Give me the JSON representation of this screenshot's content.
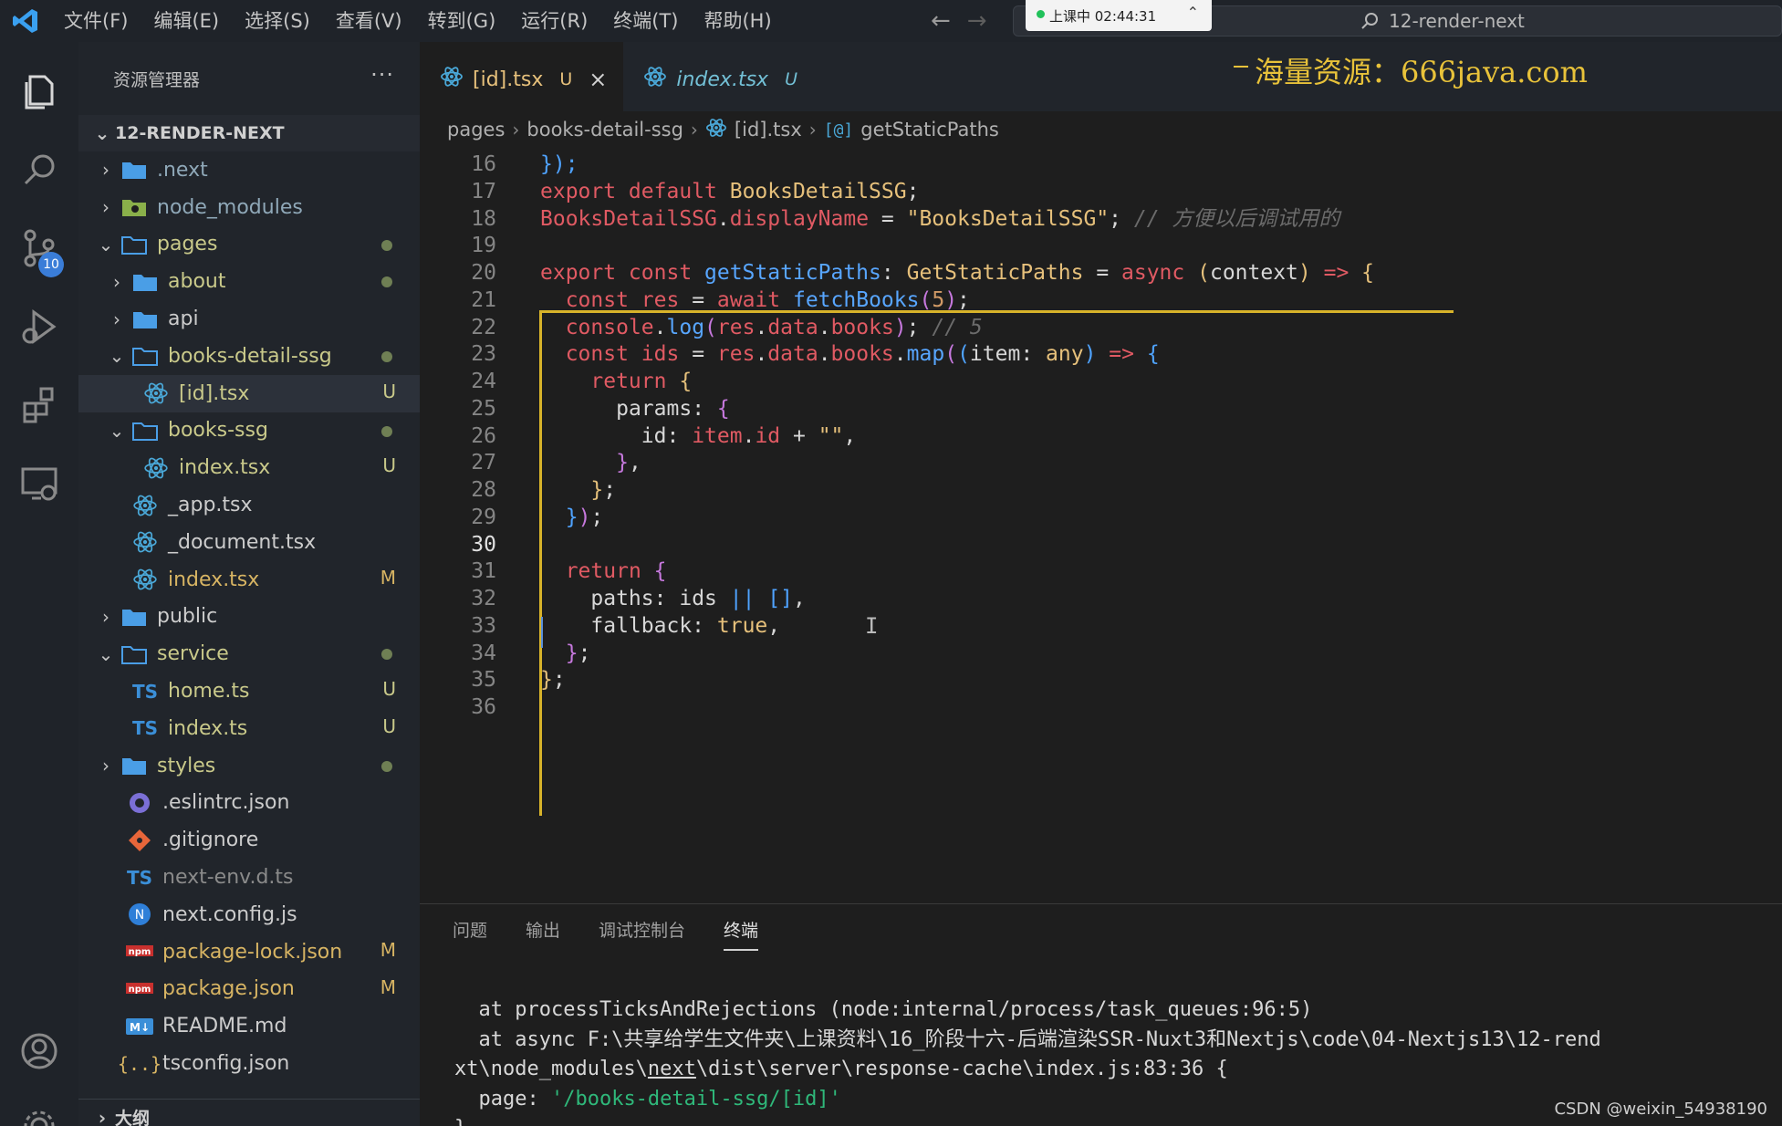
{
  "titlebar": {
    "menu": [
      "文件(F)",
      "编辑(E)",
      "选择(S)",
      "查看(V)",
      "转到(G)",
      "运行(R)",
      "终端(T)",
      "帮助(H)"
    ],
    "nav_back": "←",
    "nav_forward": "→",
    "recording": "上课中 02:44:31",
    "search": "12-render-next"
  },
  "activity_badge": "10",
  "sidebar": {
    "title": "资源管理器",
    "more": "···",
    "root": "12-RENDER-NEXT",
    "outline": "大纲",
    "items": [
      {
        "name": ".next",
        "chev": "›",
        "icon": "folder",
        "color": "#8fa8b8"
      },
      {
        "name": "node_modules",
        "chev": "›",
        "icon": "folder-node",
        "color": "#8fa8b8"
      },
      {
        "name": "pages",
        "chev": "⌄",
        "icon": "folder-open",
        "color": "#c9c98a",
        "status": "dot"
      },
      {
        "name": "about",
        "chev": "›",
        "icon": "folder",
        "color": "#c9c98a",
        "status": "dot"
      },
      {
        "name": "api",
        "chev": "›",
        "icon": "folder",
        "color": "#cccccc"
      },
      {
        "name": "books-detail-ssg",
        "chev": "⌄",
        "icon": "folder-open",
        "color": "#c9c98a",
        "status": "dot"
      },
      {
        "name": "[id].tsx",
        "icon": "react",
        "color": "#c9c98a",
        "status": "U"
      },
      {
        "name": "books-ssg",
        "chev": "⌄",
        "icon": "folder-open",
        "color": "#c9c98a",
        "status": "dot"
      },
      {
        "name": "index.tsx",
        "icon": "react",
        "color": "#c9c98a",
        "status": "U"
      },
      {
        "name": "_app.tsx",
        "icon": "react",
        "color": "#cccccc"
      },
      {
        "name": "_document.tsx",
        "icon": "react",
        "color": "#cccccc"
      },
      {
        "name": "index.tsx",
        "icon": "react",
        "color": "#d7b463",
        "status": "M"
      },
      {
        "name": "public",
        "chev": "›",
        "icon": "folder",
        "color": "#cccccc"
      },
      {
        "name": "service",
        "chev": "⌄",
        "icon": "folder-open",
        "color": "#c9c98a",
        "status": "dot"
      },
      {
        "name": "home.ts",
        "icon": "ts",
        "color": "#c9c98a",
        "status": "U"
      },
      {
        "name": "index.ts",
        "icon": "ts",
        "color": "#c9c98a",
        "status": "U"
      },
      {
        "name": "styles",
        "chev": "›",
        "icon": "folder",
        "color": "#c9c98a",
        "status": "dot"
      },
      {
        "name": ".eslintrc.json",
        "icon": "eslint",
        "color": "#cccccc"
      },
      {
        "name": ".gitignore",
        "icon": "git",
        "color": "#cccccc"
      },
      {
        "name": "next-env.d.ts",
        "icon": "ts",
        "color": "#8a8a8a"
      },
      {
        "name": "next.config.js",
        "icon": "next",
        "color": "#cccccc"
      },
      {
        "name": "package-lock.json",
        "icon": "npm",
        "color": "#d7b463",
        "status": "M"
      },
      {
        "name": "package.json",
        "icon": "npm",
        "color": "#d7b463",
        "status": "M"
      },
      {
        "name": "README.md",
        "icon": "md",
        "color": "#cccccc"
      },
      {
        "name": "tsconfig.json",
        "icon": "json",
        "color": "#cccccc"
      }
    ]
  },
  "tabs": [
    {
      "label": "[id].tsx",
      "status": "U",
      "close": "×"
    },
    {
      "label": "index.tsx",
      "status": "U"
    }
  ],
  "watermark": "海量资源：666java.com",
  "breadcrumb": [
    "pages",
    "books-detail-ssg",
    "[id].tsx",
    "getStaticPaths"
  ],
  "code": [
    {
      "n": "16",
      "t": [
        [
          "br3",
          "});"
        ]
      ]
    },
    {
      "n": "17",
      "t": [
        [
          "kw",
          "export default "
        ],
        [
          "ty",
          "BooksDetailSSG"
        ],
        [
          "pun",
          ";"
        ]
      ]
    },
    {
      "n": "18",
      "t": [
        [
          "red",
          "BooksDetailSSG"
        ],
        [
          "pun",
          "."
        ],
        [
          "red",
          "displayName"
        ],
        [
          "pun",
          " = "
        ],
        [
          "str",
          "\"BooksDetailSSG\""
        ],
        [
          "pun",
          "; "
        ],
        [
          "cmt",
          "// 方便以后调试用的"
        ]
      ]
    },
    {
      "n": "19",
      "t": []
    },
    {
      "n": "20",
      "t": [
        [
          "kw",
          "export const "
        ],
        [
          "fn",
          "getStaticPaths"
        ],
        [
          "pun",
          ": "
        ],
        [
          "ty",
          "GetStaticPaths"
        ],
        [
          "pun",
          " = "
        ],
        [
          "kw",
          "async "
        ],
        [
          "br1",
          "("
        ],
        [
          "plain",
          "context"
        ],
        [
          "br1",
          ")"
        ],
        [
          "kw",
          " => "
        ],
        [
          "br1",
          "{"
        ]
      ]
    },
    {
      "n": "21",
      "t": [
        [
          "plain",
          "  "
        ],
        [
          "kw",
          "const "
        ],
        [
          "red",
          "res"
        ],
        [
          "pun",
          " = "
        ],
        [
          "kw",
          "await "
        ],
        [
          "fn",
          "fetchBooks"
        ],
        [
          "br2",
          "("
        ],
        [
          "num",
          "5"
        ],
        [
          "br2",
          ")"
        ],
        [
          "pun",
          ";"
        ]
      ]
    },
    {
      "n": "22",
      "t": [
        [
          "plain",
          "  "
        ],
        [
          "red",
          "console"
        ],
        [
          "pun",
          "."
        ],
        [
          "fn",
          "log"
        ],
        [
          "br2",
          "("
        ],
        [
          "red",
          "res"
        ],
        [
          "pun",
          "."
        ],
        [
          "red",
          "data"
        ],
        [
          "pun",
          "."
        ],
        [
          "red",
          "books"
        ],
        [
          "br2",
          ")"
        ],
        [
          "pun",
          "; "
        ],
        [
          "cmt",
          "// 5"
        ]
      ]
    },
    {
      "n": "23",
      "t": [
        [
          "plain",
          "  "
        ],
        [
          "kw",
          "const "
        ],
        [
          "red",
          "ids"
        ],
        [
          "pun",
          " = "
        ],
        [
          "red",
          "res"
        ],
        [
          "pun",
          "."
        ],
        [
          "red",
          "data"
        ],
        [
          "pun",
          "."
        ],
        [
          "red",
          "books"
        ],
        [
          "pun",
          "."
        ],
        [
          "fn",
          "map"
        ],
        [
          "br2",
          "("
        ],
        [
          "br3",
          "("
        ],
        [
          "plain",
          "item"
        ],
        [
          "pun",
          ": "
        ],
        [
          "ty",
          "any"
        ],
        [
          "br3",
          ")"
        ],
        [
          "kw",
          " => "
        ],
        [
          "br3",
          "{"
        ]
      ]
    },
    {
      "n": "24",
      "t": [
        [
          "plain",
          "    "
        ],
        [
          "kw",
          "return "
        ],
        [
          "br1",
          "{"
        ]
      ]
    },
    {
      "n": "25",
      "t": [
        [
          "plain",
          "      "
        ],
        [
          "prop",
          "params"
        ],
        [
          "pun",
          ": "
        ],
        [
          "br2",
          "{"
        ]
      ]
    },
    {
      "n": "26",
      "t": [
        [
          "plain",
          "        "
        ],
        [
          "prop",
          "id"
        ],
        [
          "pun",
          ": "
        ],
        [
          "red",
          "item"
        ],
        [
          "pun",
          "."
        ],
        [
          "red",
          "id"
        ],
        [
          "pun",
          " + "
        ],
        [
          "str",
          "\"\""
        ],
        [
          "pun",
          ","
        ]
      ]
    },
    {
      "n": "27",
      "t": [
        [
          "plain",
          "      "
        ],
        [
          "br2",
          "}"
        ],
        [
          "pun",
          ","
        ]
      ]
    },
    {
      "n": "28",
      "t": [
        [
          "plain",
          "    "
        ],
        [
          "br1",
          "}"
        ],
        [
          "pun",
          ";"
        ]
      ]
    },
    {
      "n": "29",
      "t": [
        [
          "plain",
          "  "
        ],
        [
          "br3",
          "}"
        ],
        [
          "br2",
          ")"
        ],
        [
          "pun",
          ";"
        ]
      ]
    },
    {
      "n": "30",
      "t": [],
      "cur": true
    },
    {
      "n": "31",
      "t": [
        [
          "plain",
          "  "
        ],
        [
          "kw",
          "return "
        ],
        [
          "br2",
          "{"
        ]
      ]
    },
    {
      "n": "32",
      "t": [
        [
          "plain",
          "    "
        ],
        [
          "prop",
          "paths"
        ],
        [
          "pun",
          ": "
        ],
        [
          "plain",
          "ids"
        ],
        [
          "pun",
          " "
        ],
        [
          "br3",
          "||"
        ],
        [
          "pun",
          " "
        ],
        [
          "br3",
          "[]"
        ],
        [
          "pun",
          ","
        ]
      ]
    },
    {
      "n": "33",
      "t": [
        [
          "plain",
          "    "
        ],
        [
          "prop",
          "fallback"
        ],
        [
          "pun",
          ": "
        ],
        [
          "ty",
          "true"
        ],
        [
          "pun",
          ","
        ]
      ]
    },
    {
      "n": "34",
      "t": [
        [
          "plain",
          "  "
        ],
        [
          "br2",
          "}"
        ],
        [
          "pun",
          ";"
        ]
      ]
    },
    {
      "n": "35",
      "t": [
        [
          "br1",
          "}"
        ],
        [
          "pun",
          ";"
        ]
      ]
    },
    {
      "n": "36",
      "t": []
    }
  ],
  "panel": {
    "tabs": [
      "问题",
      "输出",
      "调试控制台",
      "终端"
    ],
    "active_tab": "终端",
    "term_line1": "  at processTicksAndRejections (node:internal/process/task_queues:96:5)",
    "term_line2": "  at async F:\\共享给学生文件夹\\上课资料\\16_阶段十六-后端渲染SSR-Nuxt3和Nextjs\\code\\04-Nextjs13\\12-rend",
    "term_line3_a": "xt\\node_modules\\",
    "term_line3_b": "next",
    "term_line3_c": "\\dist\\server\\response-cache\\index.js:83:36 {",
    "term_line4_a": "  page: ",
    "term_line4_b": "'/books-detail-ssg/[id]'",
    "term_line5": "}"
  },
  "credit": "CSDN @weixin_54938190",
  "colors": {
    "accent": "#3a7dd8",
    "modified": "#d7b463",
    "untracked": "#c9c98a",
    "watermark": "#e8c23a"
  }
}
